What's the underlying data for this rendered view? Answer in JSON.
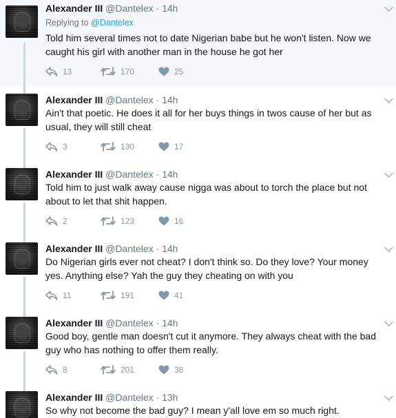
{
  "tweets": [
    {
      "name": "Alexander III",
      "handle": "@Dantelex",
      "time": "14h",
      "replying_label": "Replying to",
      "replying_to": "@Dantelex",
      "text": "Told him several times not to date Nigerian babe but he won't listen. Now we caught his girl with another man in the house he got her",
      "replies": "13",
      "retweets": "170",
      "likes": "25"
    },
    {
      "name": "Alexander III",
      "handle": "@Dantelex",
      "time": "14h",
      "text": "Ain't that poetic. He does it all for her buys things in twos cause of her but as usual, they will still cheat",
      "replies": "3",
      "retweets": "130",
      "likes": "17"
    },
    {
      "name": "Alexander III",
      "handle": "@Dantelex",
      "time": "14h",
      "text": "Told him to just walk away cause nigga was about to torch the place but not about to let that shit happen.",
      "replies": "2",
      "retweets": "123",
      "likes": "16"
    },
    {
      "name": "Alexander III",
      "handle": "@Dantelex",
      "time": "14h",
      "text": "Do Nigerian girls ever not cheat? I don't think so. Do they love? Your money yes. Anything else? Yah the guy they cheating on with you",
      "replies": "11",
      "retweets": "191",
      "likes": "41"
    },
    {
      "name": "Alexander III",
      "handle": "@Dantelex",
      "time": "14h",
      "text": "Good boy, gentle man doesn't cut it anymore. They always cheat with the bad guy who has nothing to offer them really.",
      "replies": "8",
      "retweets": "201",
      "likes": "38"
    },
    {
      "name": "Alexander III",
      "handle": "@Dantelex",
      "time": "13h",
      "text": "So why not become the bad guy? I mean y'all love em so much right.",
      "replies": "",
      "retweets": "",
      "likes": ""
    }
  ],
  "colors": {
    "thread_line": "#ccd6dd",
    "link": "#1da1f2",
    "muted": "#657786",
    "first_bg": "#f5f8fa"
  },
  "icons": {
    "reply": "reply-icon",
    "retweet": "retweet-icon",
    "like": "heart-icon",
    "menu": "chevron-down-icon"
  }
}
